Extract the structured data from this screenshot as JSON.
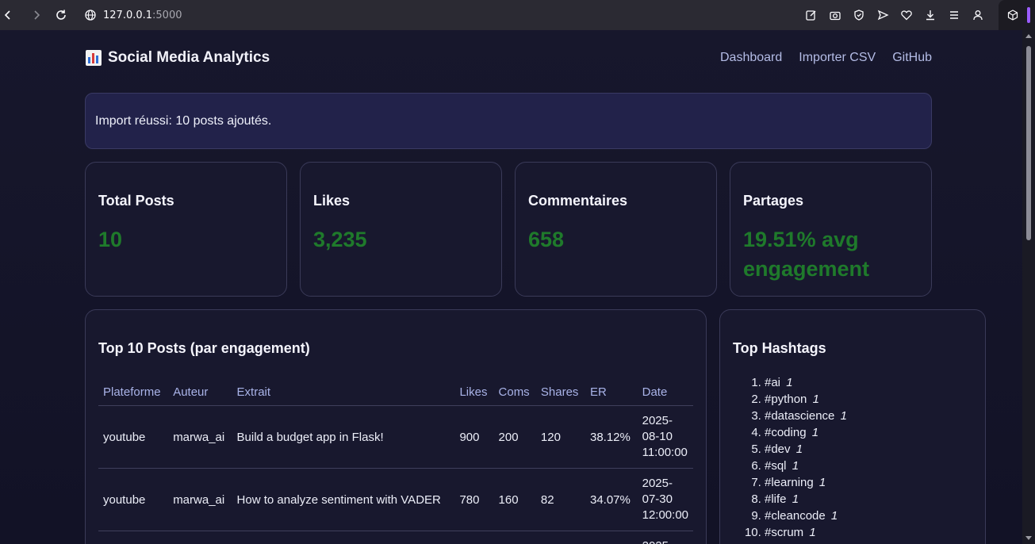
{
  "browser": {
    "url_host": "127.0.0.1",
    "url_port": ":5000"
  },
  "header": {
    "title": "Social Media Analytics",
    "nav": [
      "Dashboard",
      "Importer CSV",
      "GitHub"
    ]
  },
  "alert": "Import réussi: 10 posts ajoutés.",
  "stats": [
    {
      "label": "Total Posts",
      "value": "10"
    },
    {
      "label": "Likes",
      "value": "3,235"
    },
    {
      "label": "Commentaires",
      "value": "658"
    },
    {
      "label": "Partages",
      "value": "19.51% avg engagement"
    }
  ],
  "posts": {
    "title": "Top 10 Posts (par engagement)",
    "columns": [
      "Plateforme",
      "Auteur",
      "Extrait",
      "Likes",
      "Coms",
      "Shares",
      "ER",
      "Date"
    ],
    "rows": [
      {
        "platform": "youtube",
        "author": "marwa_ai",
        "excerpt": "Build a budget app in Flask!",
        "likes": "900",
        "coms": "200",
        "shares": "120",
        "er": "38.12%",
        "date": "2025-08-10 11:00:00"
      },
      {
        "platform": "youtube",
        "author": "marwa_ai",
        "excerpt": "How to analyze sentiment with VADER",
        "likes": "780",
        "coms": "160",
        "shares": "82",
        "er": "34.07%",
        "date": "2025-07-30 12:00:00"
      },
      {
        "platform": "",
        "author": "",
        "excerpt": "",
        "likes": "",
        "coms": "",
        "shares": "",
        "er": "",
        "date": "2025-"
      }
    ]
  },
  "hashtags": {
    "title": "Top Hashtags",
    "items": [
      {
        "tag": "#ai",
        "count": "1"
      },
      {
        "tag": "#python",
        "count": "1"
      },
      {
        "tag": "#datascience",
        "count": "1"
      },
      {
        "tag": "#coding",
        "count": "1"
      },
      {
        "tag": "#dev",
        "count": "1"
      },
      {
        "tag": "#sql",
        "count": "1"
      },
      {
        "tag": "#learning",
        "count": "1"
      },
      {
        "tag": "#life",
        "count": "1"
      },
      {
        "tag": "#cleancode",
        "count": "1"
      },
      {
        "tag": "#scrum",
        "count": "1"
      }
    ]
  },
  "colors": {
    "accent_green": "#1f7a2b",
    "link": "#b4bce6",
    "background": "#141428"
  }
}
